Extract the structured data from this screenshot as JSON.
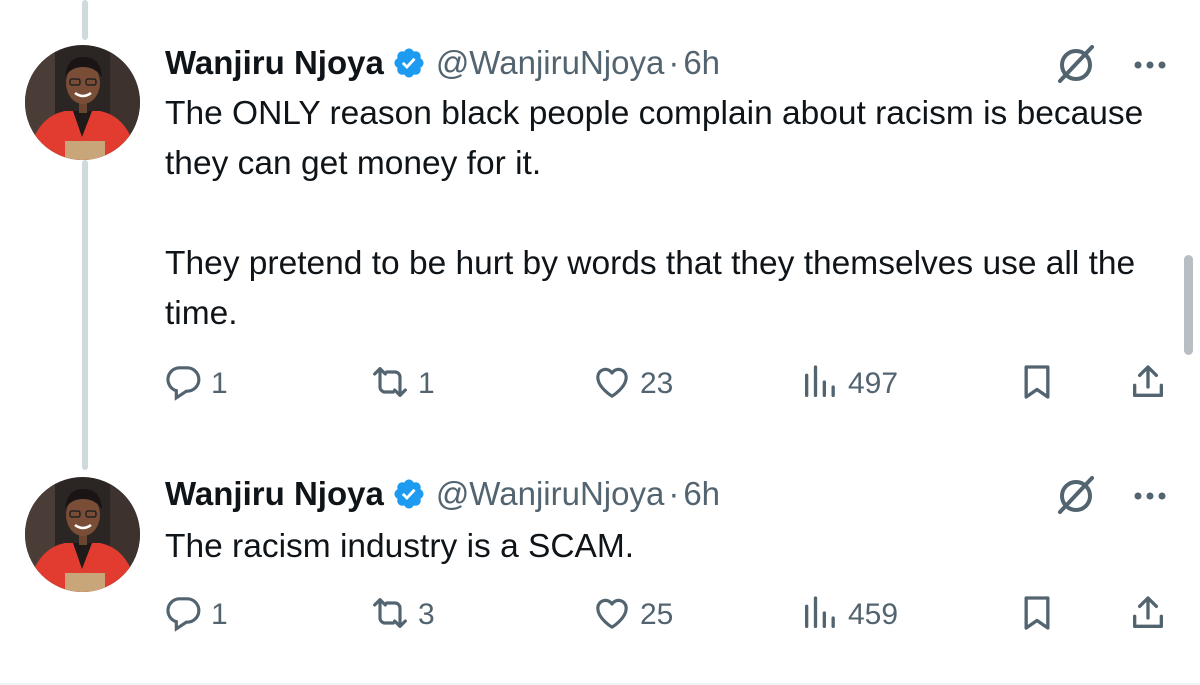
{
  "tweets": [
    {
      "author": {
        "name": "Wanjiru Njoya",
        "handle": "@WanjiruNjoya",
        "time": "6h"
      },
      "text": [
        "The ONLY reason black people complain about racism is because they can get money for it.",
        "They pretend to be hurt by words that they themselves use all the time."
      ],
      "stats": {
        "replies": "1",
        "reposts": "1",
        "likes": "23",
        "views": "497"
      }
    },
    {
      "author": {
        "name": "Wanjiru Njoya",
        "handle": "@WanjiruNjoya",
        "time": "6h"
      },
      "text": [
        "The racism industry is a SCAM."
      ],
      "stats": {
        "replies": "1",
        "reposts": "3",
        "likes": "25",
        "views": "459"
      }
    }
  ],
  "separator": "·",
  "icons": {
    "verified": "verified-badge-icon",
    "grok": "grok-icon",
    "more": "more-options-icon",
    "reply": "reply-icon",
    "repost": "repost-icon",
    "like": "like-icon",
    "views": "views-icon",
    "bookmark": "bookmark-icon",
    "share": "share-icon"
  },
  "colors": {
    "text": "#0f1419",
    "secondary": "#536471",
    "verified": "#1d9bf0",
    "thread_line": "#cfd9de"
  }
}
